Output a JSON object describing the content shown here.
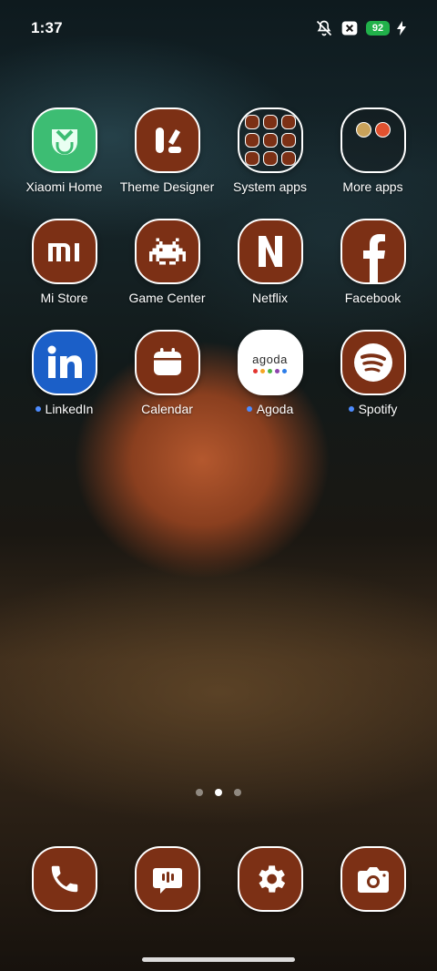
{
  "status_bar": {
    "time": "1:37",
    "battery": "92",
    "icons": [
      "mute-icon",
      "xbox-icon",
      "charge-icon"
    ]
  },
  "apps": [
    {
      "label": "Xiaomi Home",
      "icon": "xiaomi-home-icon"
    },
    {
      "label": "Theme Designer",
      "icon": "theme-designer-icon"
    },
    {
      "label": "System apps",
      "icon": "folder-icon"
    },
    {
      "label": "More apps",
      "icon": "folder-icon"
    },
    {
      "label": "Mi Store",
      "icon": "mi-store-icon"
    },
    {
      "label": "Game Center",
      "icon": "game-center-icon"
    },
    {
      "label": "Netflix",
      "icon": "netflix-icon"
    },
    {
      "label": "Facebook",
      "icon": "facebook-icon"
    },
    {
      "label": "LinkedIn",
      "icon": "linkedin-icon",
      "new": true
    },
    {
      "label": "Calendar",
      "icon": "calendar-icon"
    },
    {
      "label": "Agoda",
      "icon": "agoda-icon",
      "new": true,
      "logo_text": "agoda"
    },
    {
      "label": "Spotify",
      "icon": "spotify-icon",
      "new": true
    }
  ],
  "dock": [
    {
      "icon": "phone-icon"
    },
    {
      "icon": "messages-icon"
    },
    {
      "icon": "settings-icon"
    },
    {
      "icon": "camera-icon"
    }
  ],
  "pager": {
    "pages": 3,
    "active": 2
  },
  "colors": {
    "icon_bg": "#7c3015",
    "notify_dot": "#4d8cff",
    "battery": "#21b14a"
  }
}
